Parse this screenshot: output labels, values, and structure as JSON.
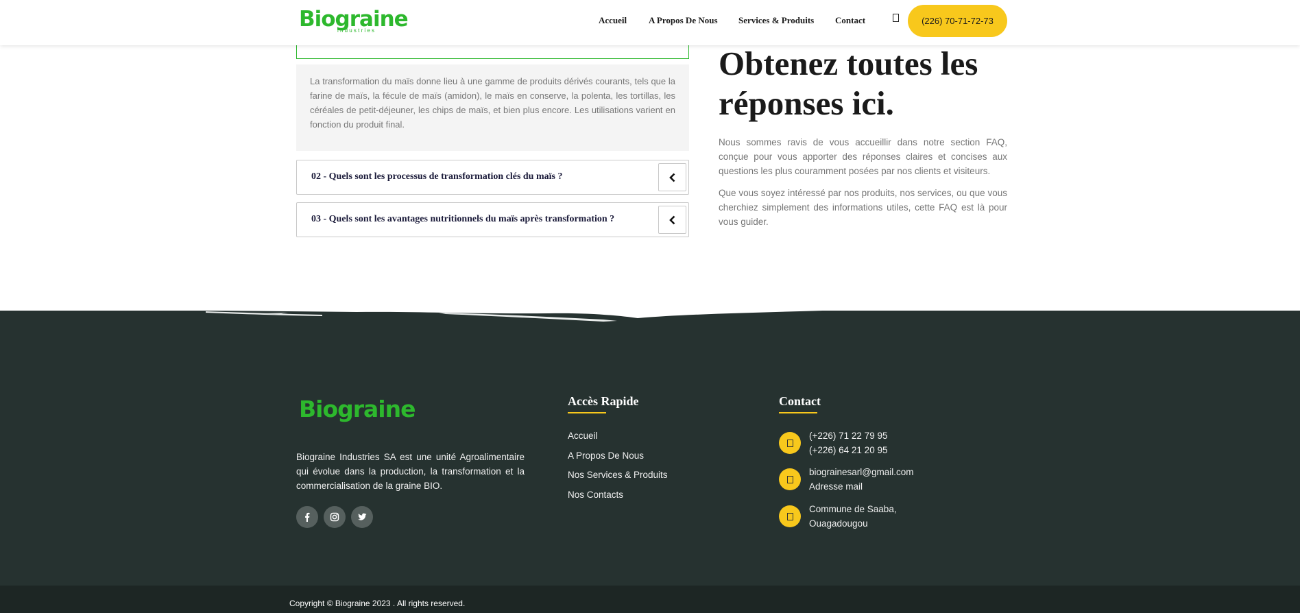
{
  "header": {
    "logo_text": "Biograine",
    "logo_sub": "industries",
    "nav": [
      "Accueil",
      "A Propos De Nous",
      "Services & Produits",
      "Contact"
    ],
    "phone_button": "(226) 70-71-72-73",
    "nav_icon": "search-icon"
  },
  "faq": {
    "open_answer": "La transformation du maïs donne lieu à une gamme de produits dérivés courants, tels que la farine de maïs, la fécule de maïs (amidon), le maïs en conserve, la polenta, les tortillas, les céréales de petit-déjeuner, les chips de maïs, et bien plus encore. Les utilisations varient en fonction du produit final.",
    "items": [
      {
        "question": "02 - Quels sont les processus de transformation clés du maïs ?"
      },
      {
        "question": "03 - Quels sont les avantages nutritionnels du maïs après transformation ?"
      }
    ],
    "title": "Obtenez toutes les réponses ici.",
    "desc1": "Nous sommes ravis de vous accueillir dans notre section FAQ, conçue pour vous apporter des réponses claires et concises aux questions les plus couramment posées par nos clients et visiteurs.",
    "desc2": "Que vous soyez intéressé par nos produits, nos services, ou que vous cherchiez simplement des informations utiles, cette FAQ est là pour vous guider."
  },
  "footer": {
    "logo_text": "Biograine",
    "about": "Biograine Industries SA est une unité Agroalimentaire qui évolue dans la production, la transformation et la commercialisation de la graine BIO.",
    "quick_title": "Accès Rapide",
    "quick_links": [
      "Accueil",
      "A Propos De Nous",
      "Nos Services & Produits",
      "Nos Contacts"
    ],
    "contact_title": "Contact",
    "contacts": [
      {
        "icon": "phone-icon",
        "line1": "(+226) 71 22 79 95",
        "line2": "(+226) 64 21 20 95"
      },
      {
        "icon": "mail-icon",
        "line1": "biograinesarl@gmail.com",
        "line2": "Adresse mail"
      },
      {
        "icon": "location-icon",
        "line1": "Commune de Saaba,",
        "line2": "Ouagadougou"
      }
    ],
    "socials": [
      "facebook-icon",
      "instagram-icon",
      "twitter-icon"
    ],
    "copyright": "Copyright © Biograine 2023 . All rights reserved."
  },
  "colors": {
    "brand_green": "#2db82d",
    "accent_yellow": "#f8c81c",
    "footer_bg": "#263230",
    "copyright_bg": "#1d2624"
  }
}
